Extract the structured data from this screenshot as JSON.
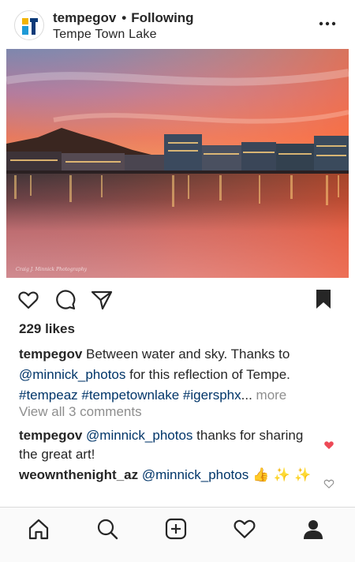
{
  "header": {
    "username": "tempegov",
    "separator": "•",
    "follow_status": "Following",
    "location": "Tempe Town Lake",
    "avatar_icon": "tempe-logo-icon",
    "more_icon": "more-options-icon"
  },
  "photo": {
    "watermark": "Craig J. Minnick Photography"
  },
  "actions": {
    "like_icon": "heart-outline-icon",
    "comment_icon": "comment-icon",
    "share_icon": "paper-plane-icon",
    "save_icon": "bookmark-filled-icon"
  },
  "likes": "229 likes",
  "caption": {
    "username": "tempegov",
    "text_1": "Between water and sky. Thanks to",
    "mention": "@minnick_photos",
    "text_2": "for this reflection of Tempe.",
    "hashtags": "#tempeaz #tempetownlake #igersphx",
    "ellipsis": "...",
    "more": "more"
  },
  "view_all_comments": "View all 3 comments",
  "comments": [
    {
      "username": "tempegov",
      "mention": "@minnick_photos",
      "text": "thanks for sharing the great art!",
      "liked": true
    },
    {
      "username": "weownthenight_az",
      "mention": "@minnick_photos",
      "text": "👍 ✨ ✨",
      "liked": false
    }
  ],
  "nav": {
    "items": [
      "home-icon",
      "search-icon",
      "new-post-icon",
      "activity-heart-icon",
      "profile-icon"
    ]
  },
  "colors": {
    "link": "#003569",
    "muted": "#8e8e8e",
    "liked_heart": "#ed4956",
    "text": "#262626"
  }
}
